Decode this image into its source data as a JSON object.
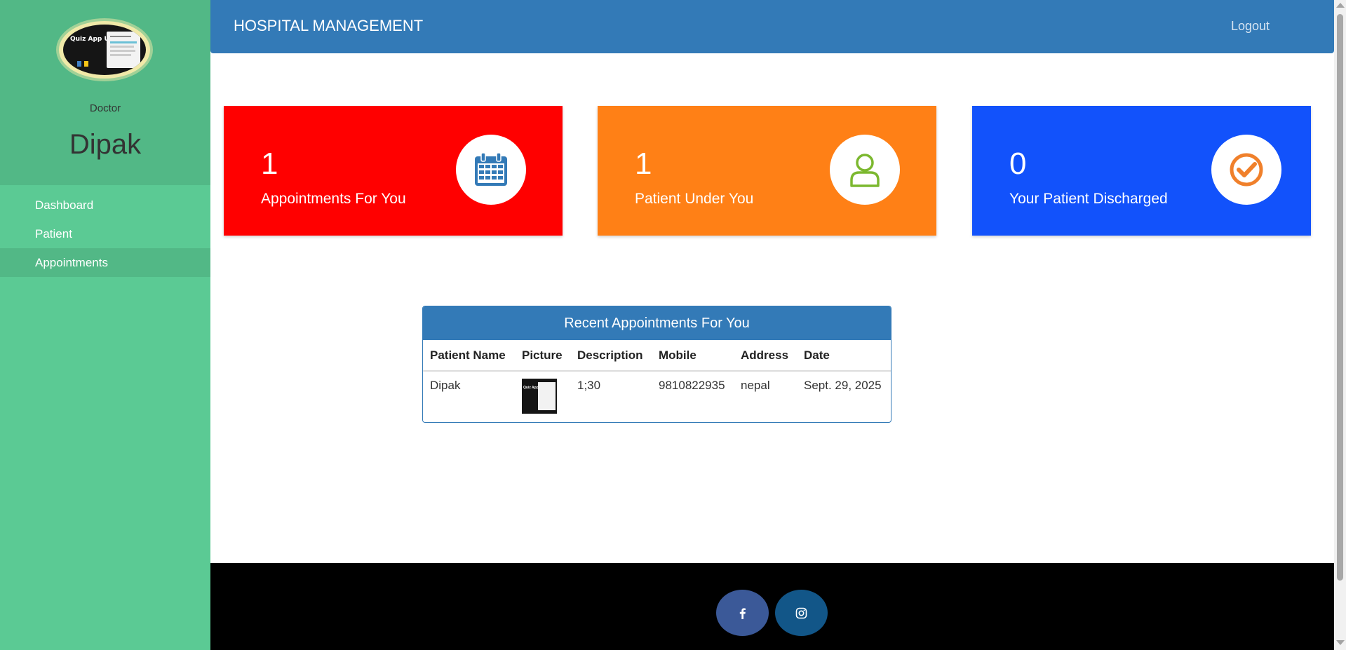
{
  "sidebar": {
    "avatar_text": "Quiz App Using ?",
    "role": "Doctor",
    "name": "Dipak",
    "items": [
      {
        "label": "Dashboard"
      },
      {
        "label": "Patient"
      },
      {
        "label": "Appointments"
      }
    ]
  },
  "header": {
    "brand": "HOSPITAL MANAGEMENT",
    "logout": "Logout"
  },
  "cards": [
    {
      "value": "1",
      "label": "Appointments For You",
      "icon": "calendar-icon",
      "color": "#ff0000",
      "icon_color": "#337ab7"
    },
    {
      "value": "1",
      "label": "Patient Under You",
      "icon": "user-icon",
      "color": "#ff8016",
      "icon_color": "#7cb82f"
    },
    {
      "value": "0",
      "label": "Your Patient Discharged",
      "icon": "check-circle-icon",
      "color": "#1252fb",
      "icon_color": "#f0802b"
    }
  ],
  "recent": {
    "title": "Recent Appointments For You",
    "columns": [
      "Patient Name",
      "Picture",
      "Description",
      "Mobile",
      "Address",
      "Date"
    ],
    "rows": [
      {
        "patient_name": "Dipak",
        "description": "1;30",
        "mobile": "9810822935",
        "address": "nepal",
        "date": "Sept. 29, 2025",
        "picture_text": "Quiz App Using ?"
      }
    ]
  },
  "footer": {
    "social": [
      {
        "icon": "facebook-icon",
        "color": "#3b5998"
      },
      {
        "icon": "instagram-icon",
        "color": "#125688"
      }
    ]
  }
}
